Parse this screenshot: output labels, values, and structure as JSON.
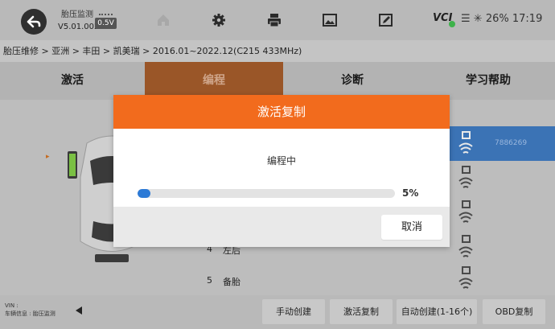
{
  "topbar": {
    "app_name": "胎压监测",
    "app_version": "V5.01.002",
    "battery_badge": "0.5V",
    "icons": [
      "back-icon",
      "home-icon",
      "settings-icon",
      "print-icon",
      "image-icon",
      "edit-icon"
    ],
    "vci_label": "VCI",
    "status_text": "26% 17:19"
  },
  "breadcrumb": "胎压维修 > 亚洲 > 丰田 > 凯美瑞 > 2016.01~2022.12(C215 433MHz)",
  "tabs": [
    {
      "label": "激活"
    },
    {
      "label": "编程"
    },
    {
      "label": "诊断"
    },
    {
      "label": "学习帮助"
    }
  ],
  "wheels": [
    {
      "num": "4",
      "name": "左后"
    },
    {
      "num": "5",
      "name": "备胎"
    }
  ],
  "sensors": {
    "selected_id": "7886269"
  },
  "bottombar": {
    "vin_label": "VIN :",
    "vehicle_info": "车辆信息 : 胎压监测",
    "buttons": [
      {
        "label": "手动创建"
      },
      {
        "label": "激活复制"
      },
      {
        "label": "自动创建(1-16个)"
      },
      {
        "label": "OBD复制"
      }
    ]
  },
  "modal": {
    "title": "激活复制",
    "message": "编程中",
    "progress_percent": 5,
    "progress_text": "5%",
    "cancel_label": "取消"
  },
  "colors": {
    "accent_orange": "#f26b1d",
    "progress_blue": "#2c7ad6",
    "selected_row": "#3b73b5"
  }
}
